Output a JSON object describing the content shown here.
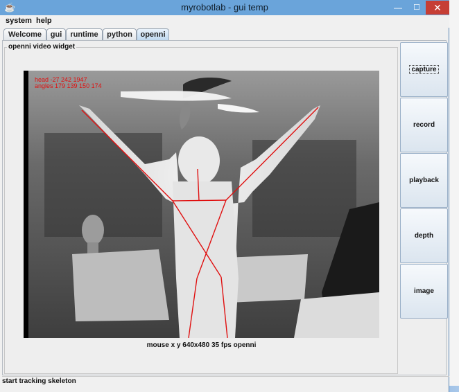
{
  "window": {
    "title": "myrobotlab - gui temp",
    "app_icon": "java-icon"
  },
  "menubar": {
    "items": [
      "system",
      "help"
    ]
  },
  "tabs": [
    {
      "label": "Welcome",
      "active": false
    },
    {
      "label": "gui",
      "active": false
    },
    {
      "label": "runtime",
      "active": false
    },
    {
      "label": "python",
      "active": false
    },
    {
      "label": "openni",
      "active": true
    }
  ],
  "widget": {
    "title": "openni video widget",
    "overlay_line1": "head -27 242 1947",
    "overlay_line2": "angles 179 139 150 174",
    "caption": "mouse x y  640x480  35 fps  openni"
  },
  "side_buttons": [
    {
      "label": "capture",
      "focused": true
    },
    {
      "label": "record",
      "focused": false
    },
    {
      "label": "playback",
      "focused": false
    },
    {
      "label": "depth",
      "focused": false
    },
    {
      "label": "image",
      "focused": false
    }
  ],
  "status": {
    "text": "start tracking skeleton"
  },
  "colors": {
    "skeleton": "#e01010",
    "titlebar": "#6aa4da",
    "close": "#c63e35"
  }
}
